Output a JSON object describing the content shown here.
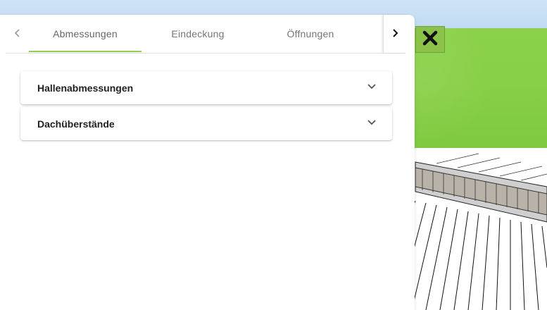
{
  "tabs": [
    {
      "label": "Abmessungen",
      "active": true
    },
    {
      "label": "Eindeckung",
      "active": false
    },
    {
      "label": "Öffnungen",
      "active": false
    }
  ],
  "icons": {
    "prev": "chevron-left-icon",
    "next": "chevron-right-icon",
    "expand": "chevron-down-icon",
    "close": "close-icon"
  },
  "sections": [
    {
      "title": "Hallenabmessungen",
      "expanded": false
    },
    {
      "title": "Dachüberstände",
      "expanded": false
    }
  ],
  "colors": {
    "accent": "#8bd24a",
    "close_button": "#8bc34a"
  }
}
